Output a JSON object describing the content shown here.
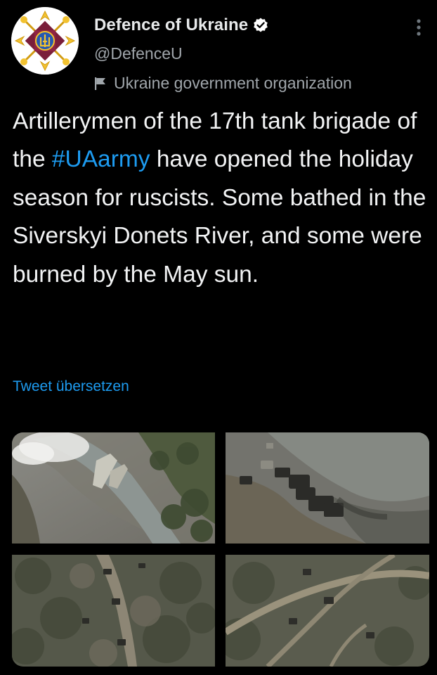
{
  "author": {
    "display_name": "Defence of Ukraine",
    "handle": "@DefenceU",
    "label": "Ukraine government organization",
    "verified": true
  },
  "tweet": {
    "text_before": "Artillerymen of the 17th tank brigade of the ",
    "hashtag": "#UAarmy",
    "text_after": " have opened the holiday season for ruscists. Some bathed in the Siverskyi Donets River, and some were burned by the May sun.",
    "translate_link": "Tweet übersetzen"
  },
  "media": {
    "count": 4,
    "items": [
      "river-bridge-smoke-photo",
      "destroyed-vehicles-river-photo",
      "forest-road-vehicles-photo",
      "field-tracks-vehicles-photo"
    ]
  },
  "icons": [
    "avatar-emblem",
    "verified-badge-icon",
    "flag-icon",
    "more-options-icon"
  ],
  "colors": {
    "background": "#000000",
    "text": "#e7e9ea",
    "secondary": "#a0a6ab",
    "accent": "#1d9bf0"
  }
}
